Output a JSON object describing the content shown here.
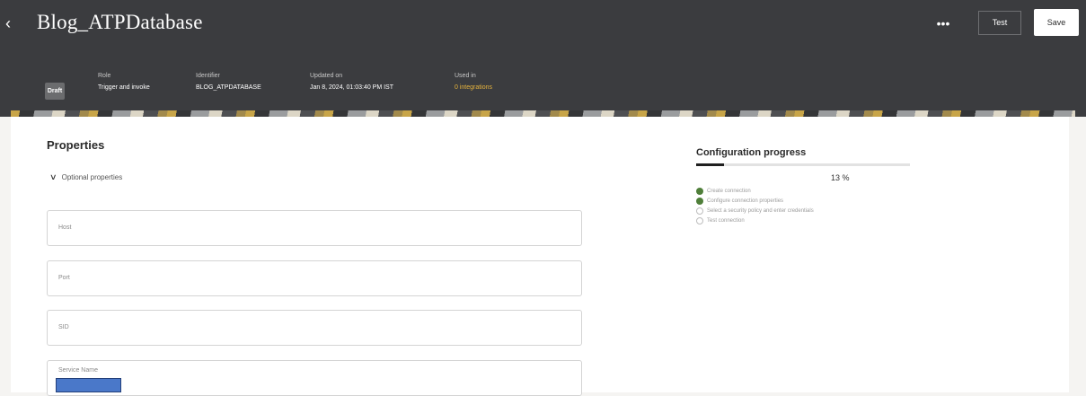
{
  "header": {
    "back_icon": "chevron-left-icon",
    "title": "Blog_ATPDatabase",
    "more_label": "•••",
    "test_label": "Test",
    "save_label": "Save",
    "status": "Draft",
    "meta": [
      {
        "label": "Role",
        "value": "Trigger and invoke"
      },
      {
        "label": "Identifier",
        "value": "BLOG_ATPDATABASE"
      },
      {
        "label": "Updated on",
        "value": "Jan 8, 2024, 01:03:40 PM IST"
      },
      {
        "label": "Used in",
        "value": "0 integrations"
      }
    ]
  },
  "properties": {
    "title": "Properties",
    "optional_label": "Optional properties",
    "fields": [
      {
        "label": "Host",
        "value": ""
      },
      {
        "label": "Port",
        "value": ""
      },
      {
        "label": "SID",
        "value": ""
      },
      {
        "label": "Service Name",
        "value": ""
      }
    ]
  },
  "config": {
    "title": "Configuration progress",
    "progress_percent": 13,
    "percent_label": "13 %",
    "steps": [
      {
        "label": "Create connection",
        "done": true
      },
      {
        "label": "Configure connection properties",
        "done": true
      },
      {
        "label": "Select a security policy and enter credentials",
        "done": false
      },
      {
        "label": "Test connection",
        "done": false
      }
    ]
  },
  "colors": {
    "header_bg": "#3b3c3f",
    "accent_link": "#e6b33d",
    "step_done": "#4f7f3a",
    "redaction": "#4a78c9"
  }
}
